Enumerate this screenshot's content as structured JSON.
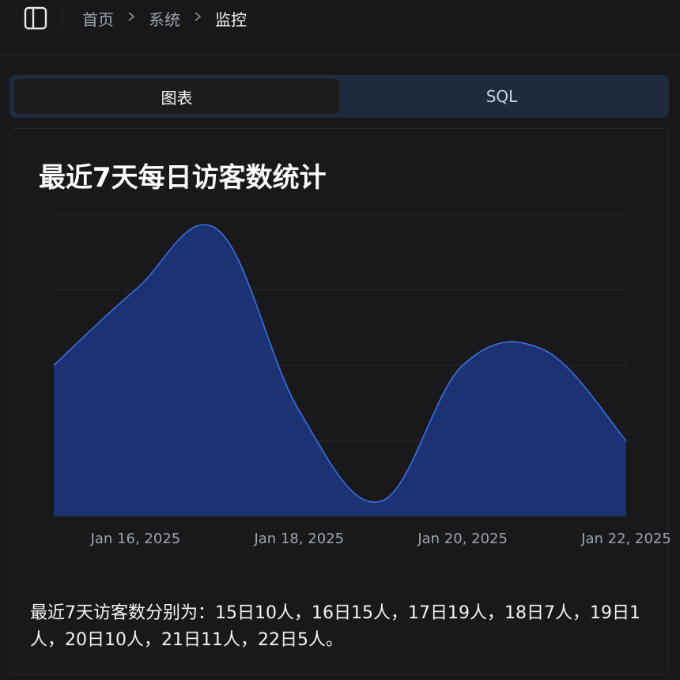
{
  "breadcrumb": {
    "items": [
      "首页",
      "系统",
      "监控"
    ]
  },
  "tabs": [
    {
      "label": "图表",
      "active": true
    },
    {
      "label": "SQL",
      "active": false
    }
  ],
  "chart_data": {
    "type": "area",
    "title": "最近7天每日访客数统计",
    "x": [
      "2025-01-15",
      "2025-01-16",
      "2025-01-17",
      "2025-01-18",
      "2025-01-19",
      "2025-01-20",
      "2025-01-21",
      "2025-01-22"
    ],
    "y": [
      10,
      15,
      19,
      7,
      1,
      10,
      11,
      5
    ],
    "tick_labels": [
      "Jan 16, 2025",
      "Jan 18, 2025",
      "Jan 20, 2025",
      "Jan 22, 2025"
    ],
    "ylim": [
      0,
      20
    ],
    "grid": true,
    "colors": {
      "fill": "#1e3a8a",
      "line": "#3b6fe0",
      "grid": "#26262c"
    }
  },
  "summary": "最近7天访客数分别为：15日10人，16日15人，17日19人，18日7人，19日1人，20日10人，21日11人，22日5人。",
  "icons": {
    "sidebar_toggle": "sidebar-toggle-icon",
    "chevron": "chevron-right-icon"
  }
}
